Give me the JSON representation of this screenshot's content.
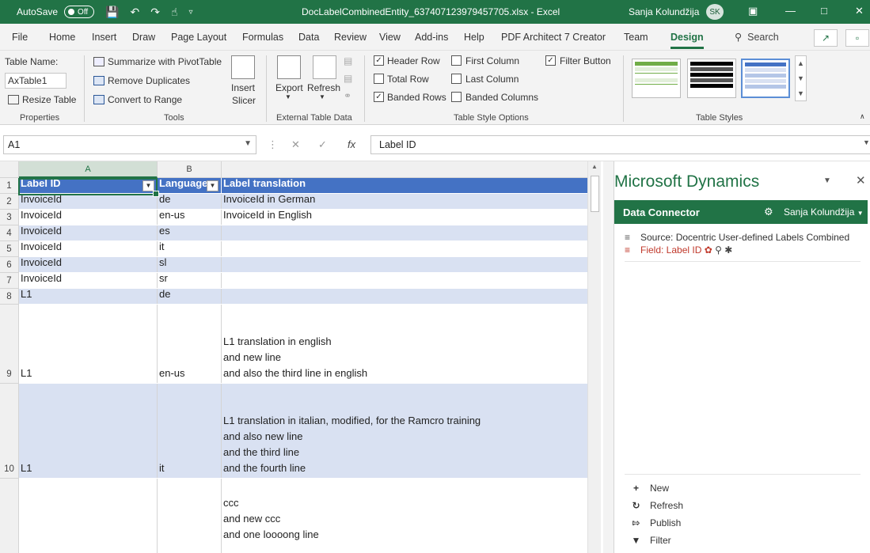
{
  "titlebar": {
    "autosave_label": "AutoSave",
    "autosave_state": "Off",
    "title": "DocLabelCombinedEntity_637407123979457705.xlsx  -  Excel",
    "user_name": "Sanja Kolundžija",
    "user_initials": "SK"
  },
  "menu": {
    "items": [
      "File",
      "Home",
      "Insert",
      "Draw",
      "Page Layout",
      "Formulas",
      "Data",
      "Review",
      "View",
      "Add-ins",
      "Help",
      "PDF Architect 7 Creator",
      "Team",
      "Design"
    ],
    "active": "Design",
    "search_label": "Search"
  },
  "ribbon": {
    "properties": {
      "label": "Properties",
      "table_name_label": "Table Name:",
      "table_name_value": "AxTable1",
      "resize_label": "Resize Table"
    },
    "tools": {
      "label": "Tools",
      "summarize": "Summarize with PivotTable",
      "remove_duplicates": "Remove Duplicates",
      "convert": "Convert to Range",
      "insert_slicer_1": "Insert",
      "insert_slicer_2": "Slicer"
    },
    "external": {
      "label": "External Table Data",
      "export": "Export",
      "refresh": "Refresh"
    },
    "style_options": {
      "label": "Table Style Options",
      "header_row": "Header Row",
      "total_row": "Total Row",
      "banded_rows": "Banded Rows",
      "first_column": "First Column",
      "last_column": "Last Column",
      "banded_columns": "Banded Columns",
      "filter_button": "Filter Button"
    },
    "table_styles": {
      "label": "Table Styles"
    }
  },
  "formula_bar": {
    "cell_ref": "A1",
    "content": "Label ID"
  },
  "grid": {
    "column_letters": [
      "A",
      "B"
    ],
    "headers": [
      "Label ID",
      "Language",
      "Label translation"
    ],
    "rows": [
      {
        "num": "2",
        "a": "InvoiceId",
        "b": "de",
        "c": "InvoiceId in German"
      },
      {
        "num": "3",
        "a": "InvoiceId",
        "b": "en-us",
        "c": "InvoiceId in English"
      },
      {
        "num": "4",
        "a": "InvoiceId",
        "b": "es",
        "c": ""
      },
      {
        "num": "5",
        "a": "InvoiceId",
        "b": "it",
        "c": ""
      },
      {
        "num": "6",
        "a": "InvoiceId",
        "b": "sl",
        "c": ""
      },
      {
        "num": "7",
        "a": "InvoiceId",
        "b": "sr",
        "c": ""
      },
      {
        "num": "8",
        "a": "L1",
        "b": "de",
        "c": ""
      },
      {
        "num": "9",
        "a": "L1",
        "b": "en-us",
        "c": "L1 translation in english\nand new line\nand also the third line in english"
      },
      {
        "num": "10",
        "a": "L1",
        "b": "it",
        "c": "L1 translation in italian, modified, for the Ramcro training\nand also new line\nand the third line\nand the fourth line"
      },
      {
        "num": "",
        "a": "",
        "b": "",
        "c": "ccc\nand new ccc\nand one loooong line"
      }
    ]
  },
  "pane": {
    "title": "Microsoft Dynamics",
    "connector_title": "Data Connector",
    "connector_user": "Sanja Kolundžija",
    "source_line": "Source: Docentric User-defined Labels Combined",
    "field_line": "Field: Label ID",
    "actions": [
      "New",
      "Refresh",
      "Publish",
      "Filter"
    ]
  },
  "colors": {
    "excel_green": "#217346",
    "table_header": "#4472c4",
    "table_band": "#d9e1f2",
    "field_red": "#c0392b"
  }
}
